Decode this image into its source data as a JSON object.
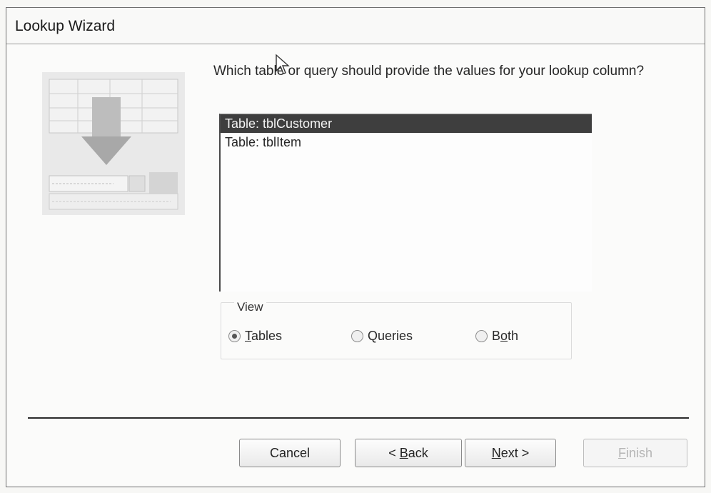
{
  "window": {
    "title": "Lookup Wizard"
  },
  "prompt": "Which table or query should provide the values for your lookup column?",
  "list": {
    "items": [
      {
        "label": "Table: tblCustomer",
        "selected": true
      },
      {
        "label": "Table: tblItem",
        "selected": false
      }
    ]
  },
  "view": {
    "legend": "View",
    "options": [
      {
        "label": "Tables",
        "mnemonic": "T",
        "rest": "ables",
        "checked": true
      },
      {
        "label": "Queries",
        "checked": false
      },
      {
        "label": "Both",
        "prefix": "B",
        "mnemonic": "o",
        "suffix": "th",
        "checked": false
      }
    ]
  },
  "buttons": {
    "cancel": "Cancel",
    "back": {
      "prefix": "< ",
      "mnemonic": "B",
      "rest": "ack"
    },
    "next": {
      "mnemonic": "N",
      "rest": "ext >"
    },
    "finish": {
      "mnemonic": "F",
      "rest": "inish",
      "disabled": true
    }
  },
  "colors": {
    "selection": "#3e3e3e",
    "selection_text": "#f4f4f4",
    "disabled_text": "#b5b5b5"
  },
  "icons": {
    "wizard_graphic": "lookup-wizard-graphic",
    "pointer": "mouse-pointer-icon"
  }
}
